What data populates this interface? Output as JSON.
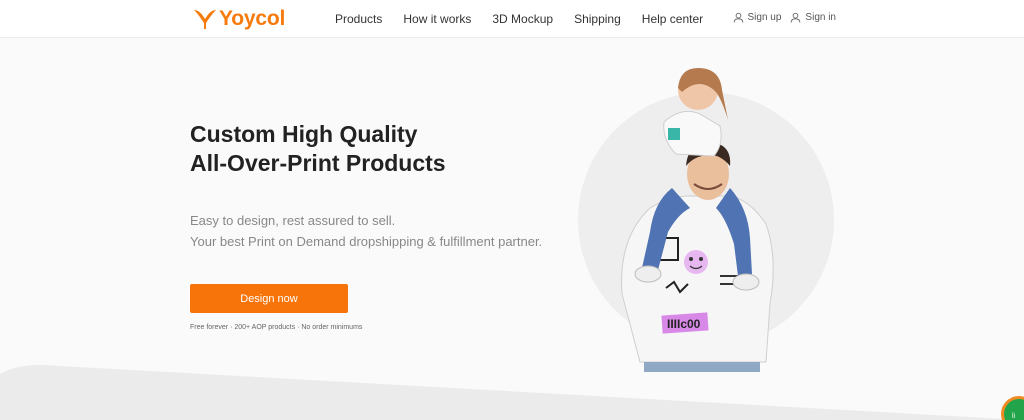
{
  "brand": {
    "name": "Yoycol",
    "color": "#f77a0c"
  },
  "nav": {
    "items": [
      {
        "label": "Products"
      },
      {
        "label": "How it works"
      },
      {
        "label": "3D Mockup"
      },
      {
        "label": "Shipping"
      },
      {
        "label": "Help center"
      }
    ]
  },
  "account": {
    "signup_label": "Sign up",
    "signup_icon": "user-icon",
    "signin_label": "Sign in",
    "signin_icon": "user-icon"
  },
  "hero": {
    "title_line1": "Custom High Quality",
    "title_line2": "All-Over-Print Products",
    "subtitle_line1": "Easy to design, rest assured to sell.",
    "subtitle_line2": "Your best Print on Demand dropshipping & fulfillment partner.",
    "cta_label": "Design now",
    "cta_color": "#f7740a",
    "features": "Free forever · 200+ AOP products · No order minimums",
    "image_sticker": "IIIIc00"
  },
  "chat_widget": {
    "icon": "chat-icon",
    "label": "li"
  }
}
